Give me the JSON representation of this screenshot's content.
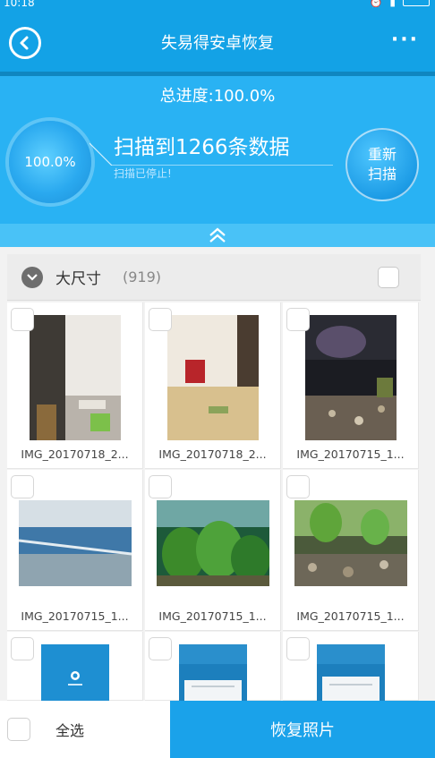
{
  "status_bar": {
    "time": "10:18"
  },
  "header": {
    "title": "失易得安卓恢复",
    "more_label": "···"
  },
  "progress": {
    "total_label": "总进度:100.0%",
    "ring_percent": "100.0%",
    "scan_count": "扫描到1266条数据",
    "scan_status": "扫描已停止!",
    "rescan_line1": "重新",
    "rescan_line2": "扫描"
  },
  "group": {
    "name": "大尺寸",
    "count": "(919)"
  },
  "photos": [
    {
      "name": "IMG_20170718_2...",
      "scene": "room-hallway"
    },
    {
      "name": "IMG_20170718_2...",
      "scene": "room-bed"
    },
    {
      "name": "IMG_20170715_1...",
      "scene": "aquarium-rocks"
    },
    {
      "name": "IMG_20170715_1...",
      "scene": "aquarium-tank-wide"
    },
    {
      "name": "IMG_20170715_1...",
      "scene": "aquarium-plants"
    },
    {
      "name": "IMG_20170715_1...",
      "scene": "aquarium-plants-stones"
    },
    {
      "name": "",
      "scene": "app-screenshot-logo"
    },
    {
      "name": "",
      "scene": "app-screenshot-dialog"
    },
    {
      "name": "",
      "scene": "app-screenshot-dialog"
    }
  ],
  "bottom": {
    "select_all_label": "全选",
    "restore_label": "恢复照片"
  },
  "colors": {
    "primary": "#13a2e6",
    "panel": "#29b2f3",
    "accent_button": "#1aa2ea"
  }
}
